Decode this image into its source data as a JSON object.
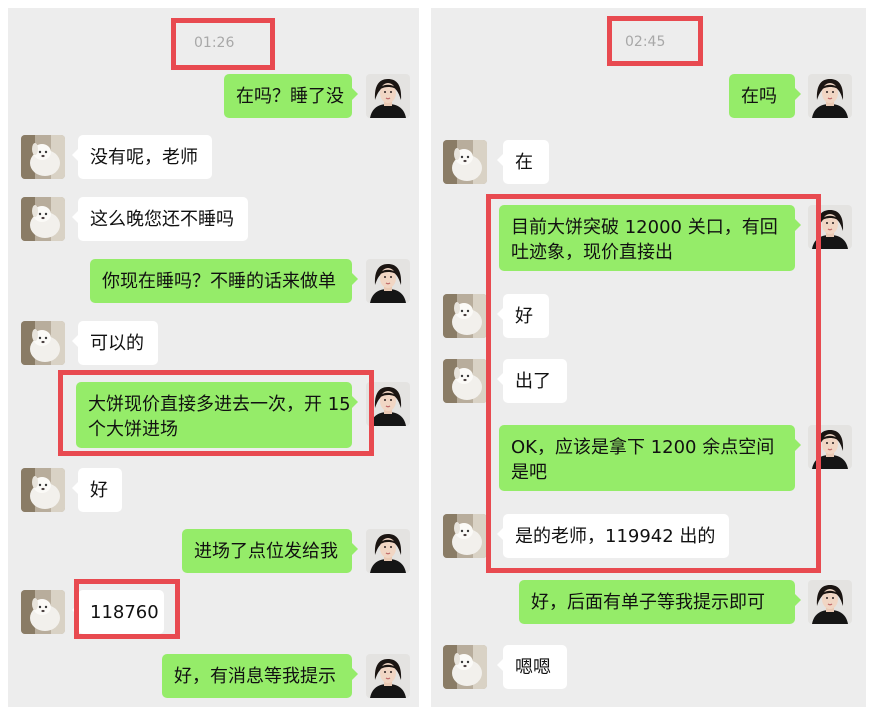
{
  "colors": {
    "background": "#ededed",
    "incoming_bubble": "#ffffff",
    "outgoing_bubble": "#95ec69",
    "timestamp": "#a8a8a8",
    "highlight": "#e84a50"
  },
  "icons": {
    "contact_avatar": "white-dog-photo",
    "self_avatar": "woman-portrait-photo"
  },
  "left_chat": {
    "timestamp": "01:26",
    "messages": [
      {
        "side": "out",
        "text": "在吗？睡了没"
      },
      {
        "side": "in",
        "text": "没有呢，老师"
      },
      {
        "side": "in",
        "text": "这么晚您还不睡吗"
      },
      {
        "side": "out",
        "text": "你现在睡吗？不睡的话来做单"
      },
      {
        "side": "in",
        "text": "可以的"
      },
      {
        "side": "out",
        "lines": [
          "大饼现价直接多进去一次，开 15",
          "个大饼进场"
        ]
      },
      {
        "side": "in",
        "text": "好"
      },
      {
        "side": "out",
        "text": "进场了点位发给我"
      },
      {
        "side": "in",
        "text": "118760"
      },
      {
        "side": "out",
        "text": "好，有消息等我提示"
      }
    ]
  },
  "right_chat": {
    "timestamp": "02:45",
    "messages": [
      {
        "side": "out",
        "text": "在吗"
      },
      {
        "side": "in",
        "text": "在"
      },
      {
        "side": "out",
        "lines": [
          "目前大饼突破 12000 关口，有回",
          "吐迹象，现价直接出"
        ]
      },
      {
        "side": "in",
        "text": "好"
      },
      {
        "side": "in",
        "text": "出了"
      },
      {
        "side": "out",
        "lines": [
          "OK，应该是拿下 1200 余点空间",
          "是吧"
        ]
      },
      {
        "side": "in",
        "text": "是的老师，119942 出的"
      },
      {
        "side": "out",
        "text": "好，后面有单子等我提示即可"
      },
      {
        "side": "in",
        "text": "嗯嗯"
      }
    ]
  }
}
